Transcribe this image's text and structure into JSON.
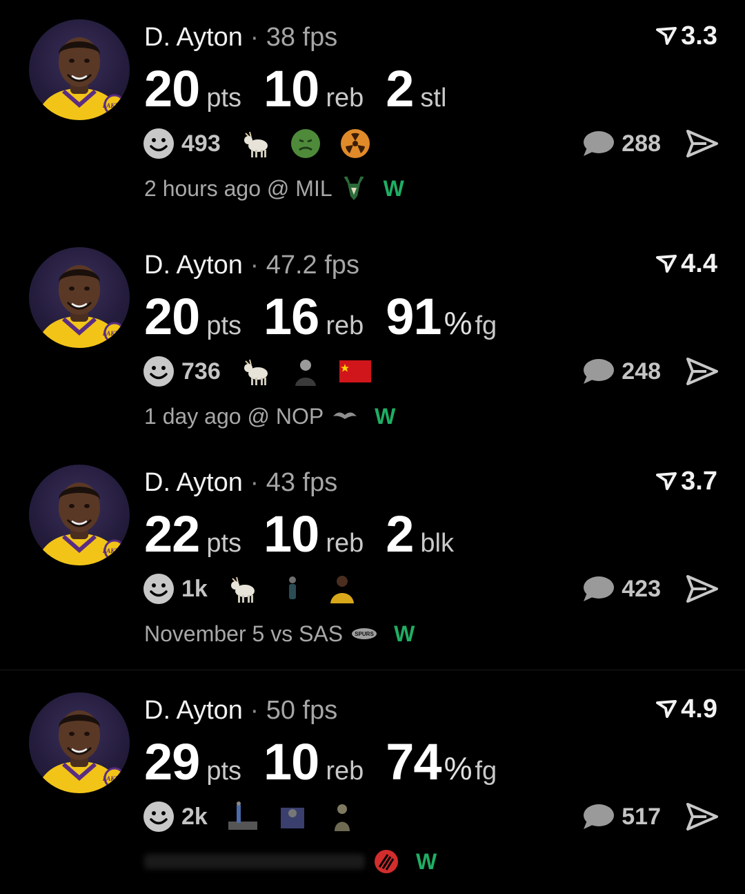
{
  "feed": {
    "cards": [
      {
        "player": "D. Ayton",
        "separator": "·",
        "fps": "38 fps",
        "rating": "3.3",
        "stats": [
          {
            "value": "20",
            "unit": "pts"
          },
          {
            "value": "10",
            "unit": "reb"
          },
          {
            "value": "2",
            "unit": "stl"
          }
        ],
        "smile_count": "493",
        "reactions": [
          "goat-icon",
          "sick-face-icon",
          "radioactive-icon"
        ],
        "comments": "288",
        "game": "2 hours ago @ MIL",
        "team_logo": "bucks-logo-icon",
        "result": "W"
      },
      {
        "player": "D. Ayton",
        "separator": "·",
        "fps": "47.2 fps",
        "rating": "4.4",
        "stats": [
          {
            "value": "20",
            "unit": "pts"
          },
          {
            "value": "16",
            "unit": "reb"
          },
          {
            "value": "91",
            "pct": "%",
            "unit": "fg"
          }
        ],
        "smile_count": "736",
        "reactions": [
          "goat-icon",
          "person-photo-icon",
          "china-flag-icon"
        ],
        "comments": "248",
        "game": "1 day ago @ NOP",
        "team_logo": "pelicans-logo-icon",
        "result": "W"
      },
      {
        "player": "D. Ayton",
        "separator": "·",
        "fps": "43 fps",
        "rating": "3.7",
        "stats": [
          {
            "value": "22",
            "unit": "pts"
          },
          {
            "value": "10",
            "unit": "reb"
          },
          {
            "value": "2",
            "unit": "blk"
          }
        ],
        "smile_count": "1k",
        "reactions": [
          "goat-icon",
          "person-photo-icon",
          "lakers-player-icon"
        ],
        "comments": "423",
        "game": "November 5 vs SAS",
        "team_logo": "spurs-logo-icon",
        "result": "W"
      },
      {
        "player": "D. Ayton",
        "separator": "·",
        "fps": "50 fps",
        "rating": "4.9",
        "stats": [
          {
            "value": "29",
            "unit": "pts"
          },
          {
            "value": "10",
            "unit": "reb"
          },
          {
            "value": "74",
            "pct": "%",
            "unit": "fg"
          }
        ],
        "smile_count": "2k",
        "reactions": [
          "dunk-photo-icon",
          "person-photo-icon",
          "statue-photo-icon"
        ],
        "comments": "517",
        "game": "",
        "team_logo": "blazers-logo-icon",
        "result": "W"
      }
    ]
  },
  "colors": {
    "background": "#000000",
    "win": "#1fae63",
    "muted": "#a8a8a8"
  }
}
